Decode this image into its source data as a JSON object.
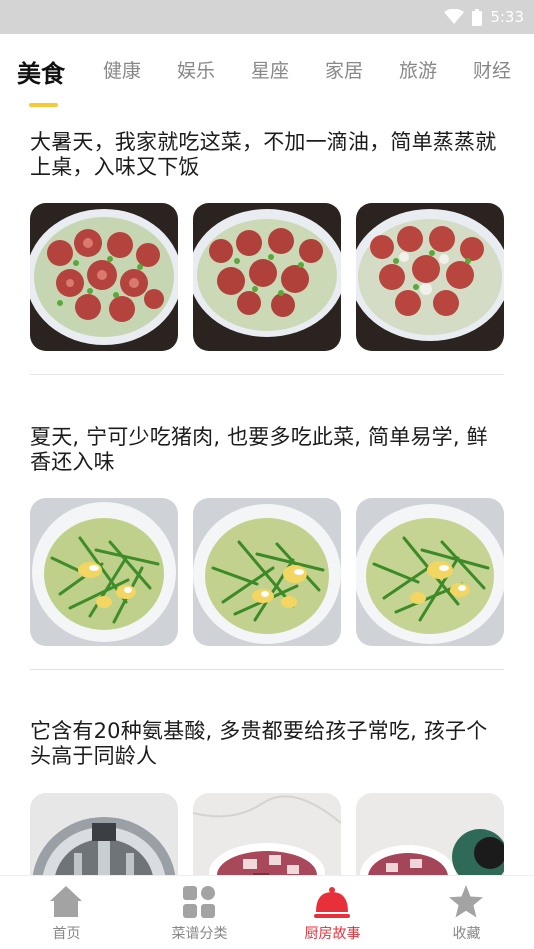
{
  "status_bar": {
    "time": "5:33"
  },
  "tabs": [
    {
      "label": "美食",
      "active": true
    },
    {
      "label": "健康"
    },
    {
      "label": "娱乐"
    },
    {
      "label": "星座"
    },
    {
      "label": "家居"
    },
    {
      "label": "旅游"
    },
    {
      "label": "财经"
    }
  ],
  "articles": [
    {
      "title": "大暑天，我家就吃这菜，不加一滴油，简单蒸蒸就上桌，入味又下饭",
      "image_subject": "steamed-sausage-dish"
    },
    {
      "title": "夏天, 宁可少吃猪肉, 也要多吃此菜, 简单易学, 鲜香还入味",
      "image_subject": "stir-fried-greens-egg-dish"
    },
    {
      "title": "它含有20种氨基酸, 多贵都要给孩子常吃, 孩子个头高于同龄人",
      "image_subject": "raw-meat-prep"
    }
  ],
  "bottom_nav": [
    {
      "label": "首页",
      "icon": "home-icon"
    },
    {
      "label": "菜谱分类",
      "icon": "grid-icon"
    },
    {
      "label": "厨房故事",
      "icon": "cloche-icon",
      "active": true
    },
    {
      "label": "收藏",
      "icon": "star-icon"
    }
  ],
  "colors": {
    "accent_indicator": "#f7c934",
    "active_nav": "#e8303a",
    "inactive_nav": "#9a9a9a",
    "status_bar": "#d4d4d4"
  }
}
